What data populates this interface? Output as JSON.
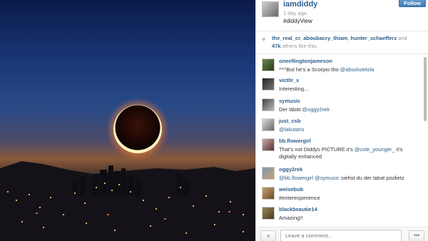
{
  "post": {
    "username": "iamdiddy",
    "time": "1 day ago",
    "caption": "#diddyView",
    "follow_label": "Follow"
  },
  "likes": {
    "users": [
      "the_real_cr",
      "aboubacry_thiam",
      "hunter_schaefferz"
    ],
    "and": "and",
    "count": "47k",
    "others_text": "others like this."
  },
  "comments": [
    {
      "user": "oneellingtonjameson",
      "text": "^^^But he's a Scorpio tho ",
      "mention": "@absolutelola",
      "after": ""
    },
    {
      "user": "vict0r_x",
      "text": "Interesting...",
      "mention": "",
      "after": ""
    },
    {
      "user": "symusic",
      "text": "Der läbät ",
      "mention": "@oggy2rek",
      "after": ""
    },
    {
      "user": "just_csb",
      "text": "",
      "mention": "@lakutaris",
      "after": ""
    },
    {
      "user": "bb.flowergirl",
      "text": "That's not Diddys PICTURE it's ",
      "mention": "@cole_younger_",
      "after": " it's digitally enhanced"
    },
    {
      "user": "oggy2rek",
      "text": "",
      "mention": "@bb.flowergirl @symusic",
      "after": " siehst du der labat pisdietz"
    },
    {
      "user": "weisebub",
      "text": "#enterexperience",
      "mention": "",
      "after": ""
    },
    {
      "user": "blackbeautie14",
      "text": "Amazing!!",
      "mention": "",
      "after": ""
    }
  ],
  "footer": {
    "comment_placeholder": "Leave a comment...",
    "more_label": "•••"
  },
  "icons": {
    "heart": "heart-icon",
    "more": "ellipsis-icon"
  },
  "colors": {
    "link": "#2d5f8c",
    "follow": "#3f7bb6"
  }
}
